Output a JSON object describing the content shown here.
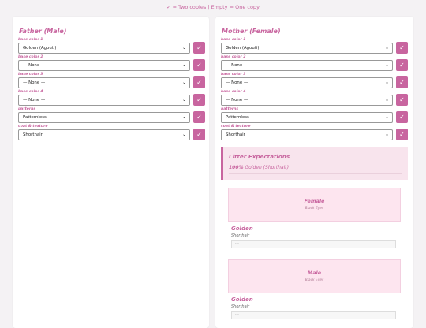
{
  "legend": "✓ = Two copies | Empty = One copy",
  "accent_color": "#c8659f",
  "father": {
    "title": "Father (Male)",
    "fields": [
      {
        "label": "base color 1",
        "value": "Golden (Agouti)"
      },
      {
        "label": "base color 2",
        "value": "— None —"
      },
      {
        "label": "base color 3",
        "value": "— None —"
      },
      {
        "label": "base color 4",
        "value": "— None —"
      },
      {
        "label": "patterns",
        "value": "Patternless"
      },
      {
        "label": "coat & texture",
        "value": "Shorthair"
      }
    ]
  },
  "mother": {
    "title": "Mother (Female)",
    "fields": [
      {
        "label": "base color 1",
        "value": "Golden (Agouti)"
      },
      {
        "label": "base color 2",
        "value": "— None —"
      },
      {
        "label": "base color 3",
        "value": "— None —"
      },
      {
        "label": "base color 4",
        "value": "— None —"
      },
      {
        "label": "patterns",
        "value": "Patternless"
      },
      {
        "label": "coat & texture",
        "value": "Shorthair"
      }
    ]
  },
  "check_glyph": "✓",
  "chevron_glyph": "⌄",
  "litter": {
    "title": "Litter Expectations",
    "percent": "100%",
    "result": "Golden (Shorthair)"
  },
  "kittens": [
    {
      "sex": "Female",
      "eyes": "Black Eyes",
      "color": "Golden",
      "coat": "Shorthair",
      "code": "- -"
    },
    {
      "sex": "Male",
      "eyes": "Black Eyes",
      "color": "Golden",
      "coat": "Shorthair",
      "code": "- -"
    }
  ]
}
